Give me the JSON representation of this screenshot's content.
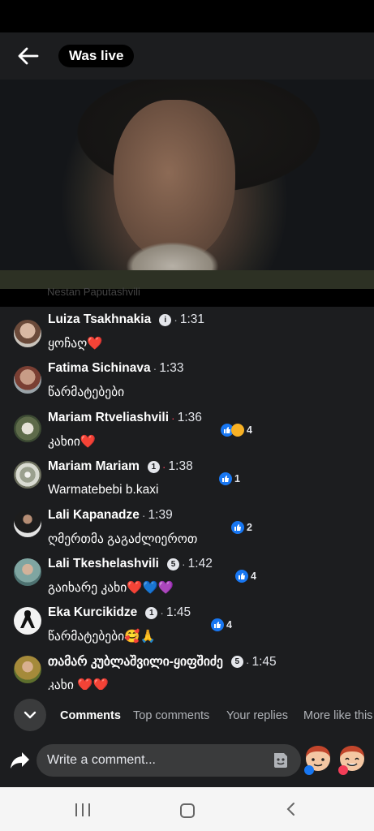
{
  "header": {
    "live_label": "Was live"
  },
  "video": {
    "faded_caption": "Nestan Paputashvili"
  },
  "comments": [
    {
      "name": "Luiza Tsakhnakia",
      "badge": "i",
      "time": "1:31",
      "text": "ყოჩაღ❤️",
      "reaction_count": ""
    },
    {
      "name": "Fatima Sichinava",
      "badge": "",
      "time": "1:33",
      "text": "წარმატებები",
      "reaction_count": ""
    },
    {
      "name": "Mariam Rtveliashvili",
      "badge": "",
      "time": "1:36",
      "text": "კახიი❤️",
      "reaction_count": "4"
    },
    {
      "name": "Mariam Mariam",
      "badge": "1",
      "time": "1:38",
      "text": "Warmatebebi b.kaxi",
      "reaction_count": "1"
    },
    {
      "name": "Lali Kapanadze",
      "badge": "",
      "time": "1:39",
      "text": "ღმერთმა გაგაძლიეროთ",
      "reaction_count": "2"
    },
    {
      "name": "Lali Tkeshelashvili",
      "badge": "5",
      "time": "1:42",
      "text": "გაიხარე კახი❤️💙💜",
      "reaction_count": "4"
    },
    {
      "name": "Eka Kurcikidze",
      "badge": "1",
      "time": "1:45",
      "text": "წარმატებები🥰🙏",
      "reaction_count": "4"
    },
    {
      "name": "თამარ კუბლაშვილი-ყიფშიძე",
      "badge": "5",
      "time": "1:45",
      "text": "კახი ❤️❤️",
      "reaction_count": ""
    }
  ],
  "tabs": [
    "Comments",
    "Top comments",
    "Your replies",
    "More like this"
  ],
  "composer": {
    "placeholder": "Write a comment..."
  },
  "colors": {
    "background": "#1c1d1f",
    "accent": "#1877f2",
    "like": "#1877f2",
    "haha": "#f7b125",
    "live_dot": "#f33e58"
  }
}
